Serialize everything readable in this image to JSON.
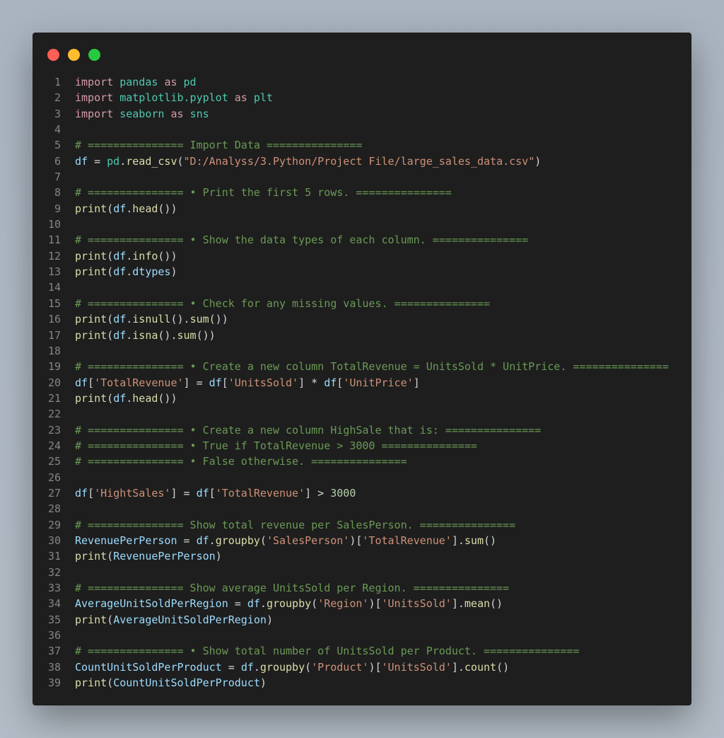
{
  "window": {
    "controls": [
      "close",
      "minimize",
      "maximize"
    ]
  },
  "colors": {
    "keyword": "#d69aa7",
    "module": "#4ec9b0",
    "variable": "#9cdcfe",
    "function": "#dcdcaa",
    "string": "#ce9178",
    "comment": "#6a9955",
    "number": "#b5cea8"
  },
  "lines": [
    [
      [
        "k",
        "import"
      ],
      [
        "p",
        " "
      ],
      [
        "m",
        "pandas"
      ],
      [
        "p",
        " "
      ],
      [
        "k",
        "as"
      ],
      [
        "p",
        " "
      ],
      [
        "m",
        "pd"
      ]
    ],
    [
      [
        "k",
        "import"
      ],
      [
        "p",
        " "
      ],
      [
        "m",
        "matplotlib.pyplot"
      ],
      [
        "p",
        " "
      ],
      [
        "k",
        "as"
      ],
      [
        "p",
        " "
      ],
      [
        "m",
        "plt"
      ]
    ],
    [
      [
        "k",
        "import"
      ],
      [
        "p",
        " "
      ],
      [
        "m",
        "seaborn"
      ],
      [
        "p",
        " "
      ],
      [
        "k",
        "as"
      ],
      [
        "p",
        " "
      ],
      [
        "m",
        "sns"
      ]
    ],
    [],
    [
      [
        "c",
        "# =============== Import Data ==============="
      ]
    ],
    [
      [
        "v",
        "df"
      ],
      [
        "p",
        " = "
      ],
      [
        "m",
        "pd"
      ],
      [
        "p",
        "."
      ],
      [
        "f",
        "read_csv"
      ],
      [
        "p",
        "("
      ],
      [
        "s",
        "\"D:/Analyss/3.Python/Project File/large_sales_data.csv\""
      ],
      [
        "p",
        ")"
      ]
    ],
    [],
    [
      [
        "c",
        "# =============== • Print the first 5 rows. ==============="
      ]
    ],
    [
      [
        "f",
        "print"
      ],
      [
        "p",
        "("
      ],
      [
        "v",
        "df"
      ],
      [
        "p",
        "."
      ],
      [
        "f",
        "head"
      ],
      [
        "p",
        "())"
      ]
    ],
    [],
    [
      [
        "c",
        "# =============== • Show the data types of each column. ==============="
      ]
    ],
    [
      [
        "f",
        "print"
      ],
      [
        "p",
        "("
      ],
      [
        "v",
        "df"
      ],
      [
        "p",
        "."
      ],
      [
        "f",
        "info"
      ],
      [
        "p",
        "())"
      ]
    ],
    [
      [
        "f",
        "print"
      ],
      [
        "p",
        "("
      ],
      [
        "v",
        "df"
      ],
      [
        "p",
        "."
      ],
      [
        "v",
        "dtypes"
      ],
      [
        "p",
        ")"
      ]
    ],
    [],
    [
      [
        "c",
        "# =============== • Check for any missing values. ==============="
      ]
    ],
    [
      [
        "f",
        "print"
      ],
      [
        "p",
        "("
      ],
      [
        "v",
        "df"
      ],
      [
        "p",
        "."
      ],
      [
        "f",
        "isnull"
      ],
      [
        "p",
        "()."
      ],
      [
        "f",
        "sum"
      ],
      [
        "p",
        "())"
      ]
    ],
    [
      [
        "f",
        "print"
      ],
      [
        "p",
        "("
      ],
      [
        "v",
        "df"
      ],
      [
        "p",
        "."
      ],
      [
        "f",
        "isna"
      ],
      [
        "p",
        "()."
      ],
      [
        "f",
        "sum"
      ],
      [
        "p",
        "())"
      ]
    ],
    [],
    [
      [
        "c",
        "# =============== • Create a new column TotalRevenue = UnitsSold * UnitPrice. ==============="
      ]
    ],
    [
      [
        "v",
        "df"
      ],
      [
        "p",
        "["
      ],
      [
        "s",
        "'TotalRevenue'"
      ],
      [
        "p",
        "] = "
      ],
      [
        "v",
        "df"
      ],
      [
        "p",
        "["
      ],
      [
        "s",
        "'UnitsSold'"
      ],
      [
        "p",
        "] * "
      ],
      [
        "v",
        "df"
      ],
      [
        "p",
        "["
      ],
      [
        "s",
        "'UnitPrice'"
      ],
      [
        "p",
        "]"
      ]
    ],
    [
      [
        "f",
        "print"
      ],
      [
        "p",
        "("
      ],
      [
        "v",
        "df"
      ],
      [
        "p",
        "."
      ],
      [
        "f",
        "head"
      ],
      [
        "p",
        "())"
      ]
    ],
    [],
    [
      [
        "c",
        "# =============== • Create a new column HighSale that is: ==============="
      ]
    ],
    [
      [
        "c",
        "# =============== • True if TotalRevenue > 3000 ==============="
      ]
    ],
    [
      [
        "c",
        "# =============== • False otherwise. ==============="
      ]
    ],
    [],
    [
      [
        "v",
        "df"
      ],
      [
        "p",
        "["
      ],
      [
        "s",
        "'HightSales'"
      ],
      [
        "p",
        "] = "
      ],
      [
        "v",
        "df"
      ],
      [
        "p",
        "["
      ],
      [
        "s",
        "'TotalRevenue'"
      ],
      [
        "p",
        "] > "
      ],
      [
        "n",
        "3000"
      ]
    ],
    [],
    [
      [
        "c",
        "# =============== Show total revenue per SalesPerson. ==============="
      ]
    ],
    [
      [
        "v",
        "RevenuePerPerson"
      ],
      [
        "p",
        " = "
      ],
      [
        "v",
        "df"
      ],
      [
        "p",
        "."
      ],
      [
        "f",
        "groupby"
      ],
      [
        "p",
        "("
      ],
      [
        "s",
        "'SalesPerson'"
      ],
      [
        "p",
        ")["
      ],
      [
        "s",
        "'TotalRevenue'"
      ],
      [
        "p",
        "]."
      ],
      [
        "f",
        "sum"
      ],
      [
        "p",
        "()"
      ]
    ],
    [
      [
        "f",
        "print"
      ],
      [
        "p",
        "("
      ],
      [
        "v",
        "RevenuePerPerson"
      ],
      [
        "p",
        ")"
      ]
    ],
    [],
    [
      [
        "c",
        "# =============== Show average UnitsSold per Region. ==============="
      ]
    ],
    [
      [
        "v",
        "AverageUnitSoldPerRegion"
      ],
      [
        "p",
        " = "
      ],
      [
        "v",
        "df"
      ],
      [
        "p",
        "."
      ],
      [
        "f",
        "groupby"
      ],
      [
        "p",
        "("
      ],
      [
        "s",
        "'Region'"
      ],
      [
        "p",
        ")["
      ],
      [
        "s",
        "'UnitsSold'"
      ],
      [
        "p",
        "]."
      ],
      [
        "f",
        "mean"
      ],
      [
        "p",
        "()"
      ]
    ],
    [
      [
        "f",
        "print"
      ],
      [
        "p",
        "("
      ],
      [
        "v",
        "AverageUnitSoldPerRegion"
      ],
      [
        "p",
        ")"
      ]
    ],
    [],
    [
      [
        "c",
        "# =============== • Show total number of UnitsSold per Product. ==============="
      ]
    ],
    [
      [
        "v",
        "CountUnitSoldPerProduct"
      ],
      [
        "p",
        " = "
      ],
      [
        "v",
        "df"
      ],
      [
        "p",
        "."
      ],
      [
        "f",
        "groupby"
      ],
      [
        "p",
        "("
      ],
      [
        "s",
        "'Product'"
      ],
      [
        "p",
        ")["
      ],
      [
        "s",
        "'UnitsSold'"
      ],
      [
        "p",
        "]."
      ],
      [
        "f",
        "count"
      ],
      [
        "p",
        "()"
      ]
    ],
    [
      [
        "f",
        "print"
      ],
      [
        "p",
        "("
      ],
      [
        "v",
        "CountUnitSoldPerProduct"
      ],
      [
        "p",
        ")"
      ]
    ]
  ]
}
